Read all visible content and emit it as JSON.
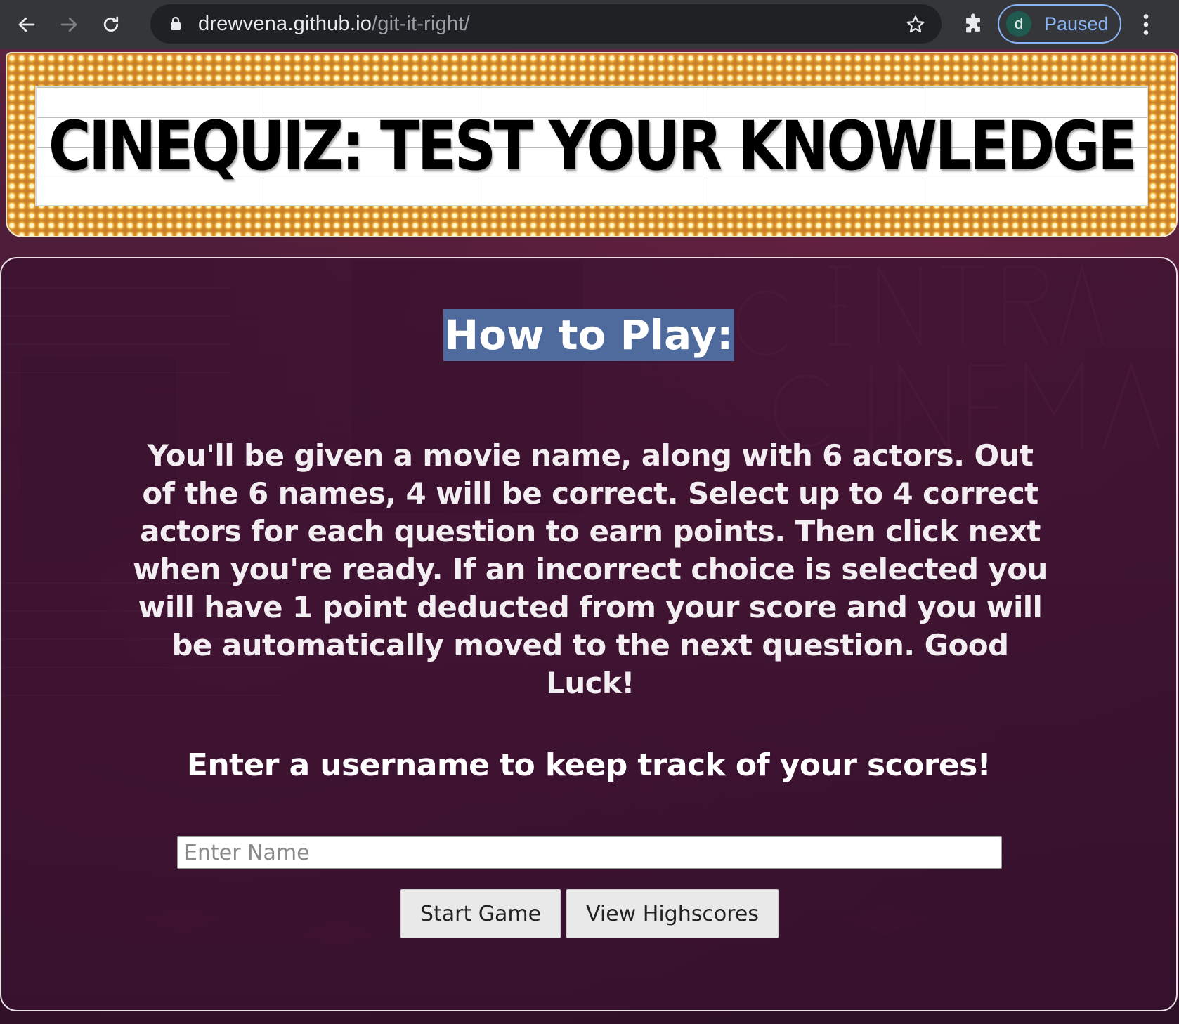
{
  "browser": {
    "url_host": "drewvena.github.io",
    "url_path": "/git-it-right/",
    "profile_initial": "d",
    "profile_status": "Paused",
    "accent_color": "#8ab4f8"
  },
  "header": {
    "title": "CINEQUIZ: TEST YOUR KNOWLEDGE"
  },
  "main": {
    "heading": "How to Play:",
    "instructions": "You'll be given a movie name, along with 6 actors. Out of the 6 names, 4 will be correct. Select up to 4 correct actors for each question to earn points. Then click next when you're ready. If an incorrect choice is selected you will have 1 point deducted from your score and you will be automatically moved to the next question. Good Luck!",
    "username_prompt": "Enter a username to keep track of your scores!",
    "name_input": {
      "value": "",
      "placeholder": "Enter Name"
    },
    "start_button": "Start Game",
    "highscores_button": "View Highscores"
  },
  "icons": [
    "back-arrow-icon",
    "forward-arrow-icon",
    "reload-icon",
    "lock-icon",
    "star-icon",
    "extensions-puzzle-icon",
    "menu-kebab-icon"
  ],
  "colors": {
    "heading_highlight": "#4f6a9c",
    "panel_bg": "#3a1230",
    "marquee_bulbs": "#f4b640"
  }
}
